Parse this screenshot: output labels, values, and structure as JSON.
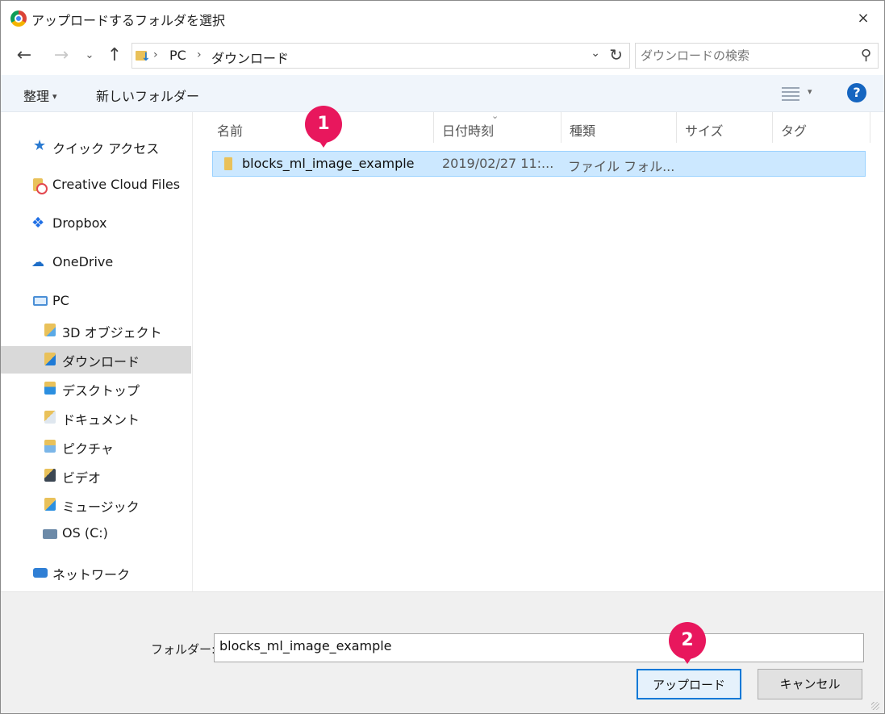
{
  "window": {
    "title": "アップロードするフォルダを選択",
    "close_glyph": "×"
  },
  "nav": {
    "back_glyph": "←",
    "forward_glyph": "→",
    "recent_glyph": "⌄",
    "up_glyph": "↑",
    "address": [
      "PC",
      "ダウンロード"
    ],
    "separator_glyph": "›",
    "dropdown_glyph": "⌄",
    "refresh_glyph": "↻",
    "search_placeholder": "ダウンロードの検索",
    "search_glyph": "⚲"
  },
  "commandbar": {
    "organize_label": "整理",
    "organize_caret": "▾",
    "newfolder_label": "新しいフォルダー",
    "view_caret": "▾",
    "help_label": "?"
  },
  "sidebar": {
    "items": [
      {
        "label": "クイック アクセス",
        "icon": "star-icon"
      },
      {
        "label": "Creative Cloud Files",
        "icon": "creative-cloud-icon"
      },
      {
        "label": "Dropbox",
        "icon": "dropbox-icon"
      },
      {
        "label": "OneDrive",
        "icon": "onedrive-icon"
      },
      {
        "label": "PC",
        "icon": "pc-icon"
      },
      {
        "label": "3D オブジェクト",
        "icon": "3d-objects-folder-icon"
      },
      {
        "label": "ダウンロード",
        "icon": "downloads-folder-icon"
      },
      {
        "label": "デスクトップ",
        "icon": "desktop-folder-icon"
      },
      {
        "label": "ドキュメント",
        "icon": "documents-folder-icon"
      },
      {
        "label": "ピクチャ",
        "icon": "pictures-folder-icon"
      },
      {
        "label": "ビデオ",
        "icon": "videos-folder-icon"
      },
      {
        "label": "ミュージック",
        "icon": "music-folder-icon"
      },
      {
        "label": "OS (C:)",
        "icon": "drive-icon"
      },
      {
        "label": "ネットワーク",
        "icon": "network-icon"
      }
    ],
    "selected": "ダウンロード",
    "star_glyph": "★",
    "dropbox_glyph": "❖",
    "onedrive_glyph": "☁"
  },
  "filelist": {
    "columns": [
      "名前",
      "日付時刻",
      "種類",
      "サイズ",
      "タグ"
    ],
    "sort_caret": "⌄",
    "rows": [
      {
        "name": "blocks_ml_image_example",
        "date": "2019/02/27 11:...",
        "type": "ファイル フォル..."
      }
    ]
  },
  "footer": {
    "folder_label": "フォルダー:",
    "folder_value": "blocks_ml_image_example",
    "upload_label": "アップロード",
    "cancel_label": "キャンセル"
  },
  "callouts": [
    "1",
    "2"
  ],
  "colors": {
    "accent": "#0078d7",
    "selection": "#cce8ff",
    "callout": "#e8175d",
    "help": "#1565c0"
  }
}
